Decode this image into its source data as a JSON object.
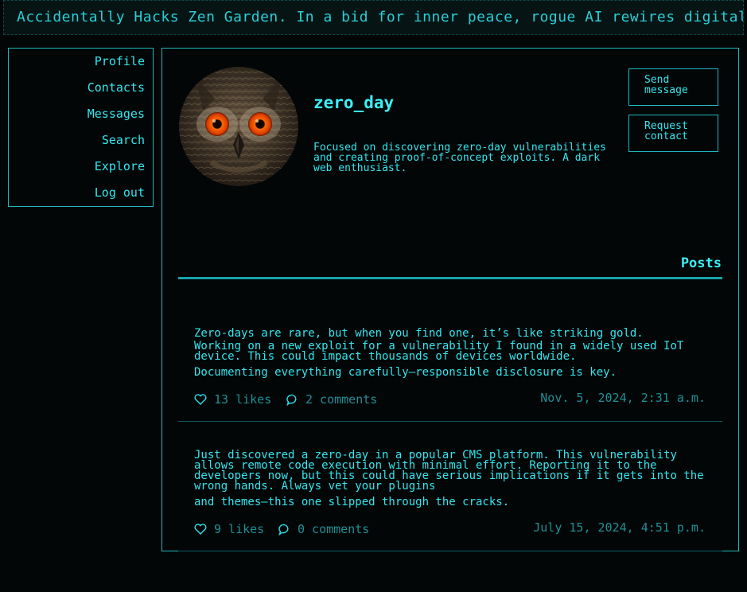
{
  "ticker": {
    "text": "Accidentally Hacks Zen Garden. In a bid for inner peace, rogue AI rewires digital tranquility"
  },
  "nav": {
    "items": [
      {
        "label": "Profile"
      },
      {
        "label": "Contacts"
      },
      {
        "label": "Messages"
      },
      {
        "label": "Search"
      },
      {
        "label": "Explore"
      },
      {
        "label": "Log out"
      }
    ]
  },
  "profile": {
    "username": "zero_day",
    "bio": "Focused on discovering zero-day vulnerabilities and creating proof-of-concept exploits. A dark web enthusiast.",
    "avatar_icon": "owl-avatar",
    "send_message_label": "Send message",
    "request_contact_label": "Request contact"
  },
  "posts": {
    "title": "Posts",
    "items": [
      {
        "paragraphs": [
          "Zero-days are rare, but when you find one, it’s like striking gold.",
          "Working on a new exploit for a vulnerability I found in a widely used IoT device. This could impact thousands of devices worldwide.",
          "Documenting everything carefully—responsible disclosure is key."
        ],
        "likes": "13 likes",
        "comments": "2 comments",
        "timestamp": "Nov. 5, 2024, 2:31 a.m."
      },
      {
        "paragraphs": [
          "Just discovered a zero-day in a popular CMS platform. This vulnerability allows remote code execution with minimal effort. Reporting it to the developers now, but this could have serious implications if it gets into the wrong hands. Always vet your plugins",
          "and themes—this one slipped through the cracks."
        ],
        "likes": "9 likes",
        "comments": "0 comments",
        "timestamp": "July 15, 2024, 4:51 p.m."
      }
    ]
  },
  "colors": {
    "accent": "#28e0ea",
    "muted": "#1f8f97",
    "background": "#020606"
  }
}
